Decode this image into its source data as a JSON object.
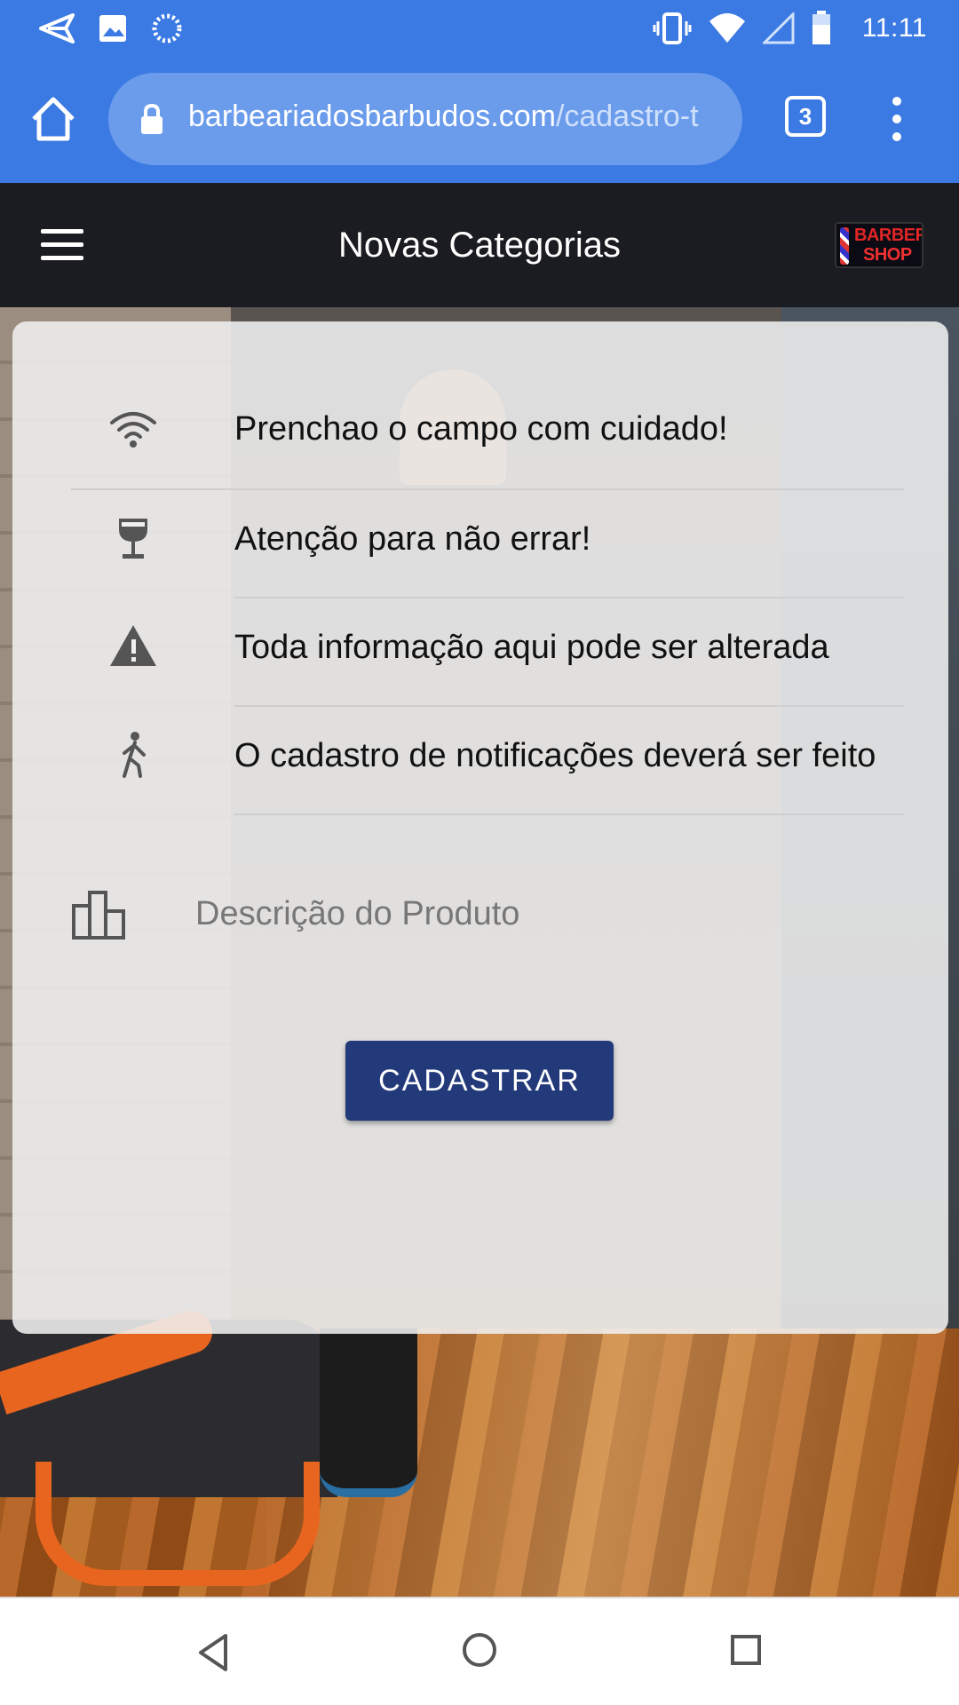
{
  "status_bar": {
    "time": "11:11",
    "left_icons": [
      "send-icon",
      "image-icon",
      "circle-progress-icon"
    ],
    "right_icons": [
      "vibrate-icon",
      "wifi-icon",
      "signal-icon",
      "battery-icon"
    ]
  },
  "browser": {
    "url_host": "barbeariadosbarbudos.com",
    "url_path": "/cadastro-t",
    "tab_count": "3"
  },
  "app": {
    "title": "Novas Categorias",
    "logo_line1": "BARBER",
    "logo_line2": "SHOP"
  },
  "form": {
    "rows": [
      {
        "icon": "wifi-icon",
        "text": "Prenchao o campo com cuidado!"
      },
      {
        "icon": "wine-glass-icon",
        "text": "Atenção para não errar!"
      },
      {
        "icon": "warning-icon",
        "text": "Toda informação aqui pode ser alterada"
      },
      {
        "icon": "walking-person-icon",
        "text": "O cadastro de notificações deverá ser feito"
      }
    ],
    "description_placeholder": "Descrição do Produto",
    "description_value": "",
    "submit_label": "CADASTRAR"
  },
  "nav": {
    "items": [
      "back-icon",
      "home-icon",
      "recents-icon"
    ]
  },
  "colors": {
    "status_bar": "#3b7ae3",
    "header": "#1b1c21",
    "button": "#233a7a"
  }
}
